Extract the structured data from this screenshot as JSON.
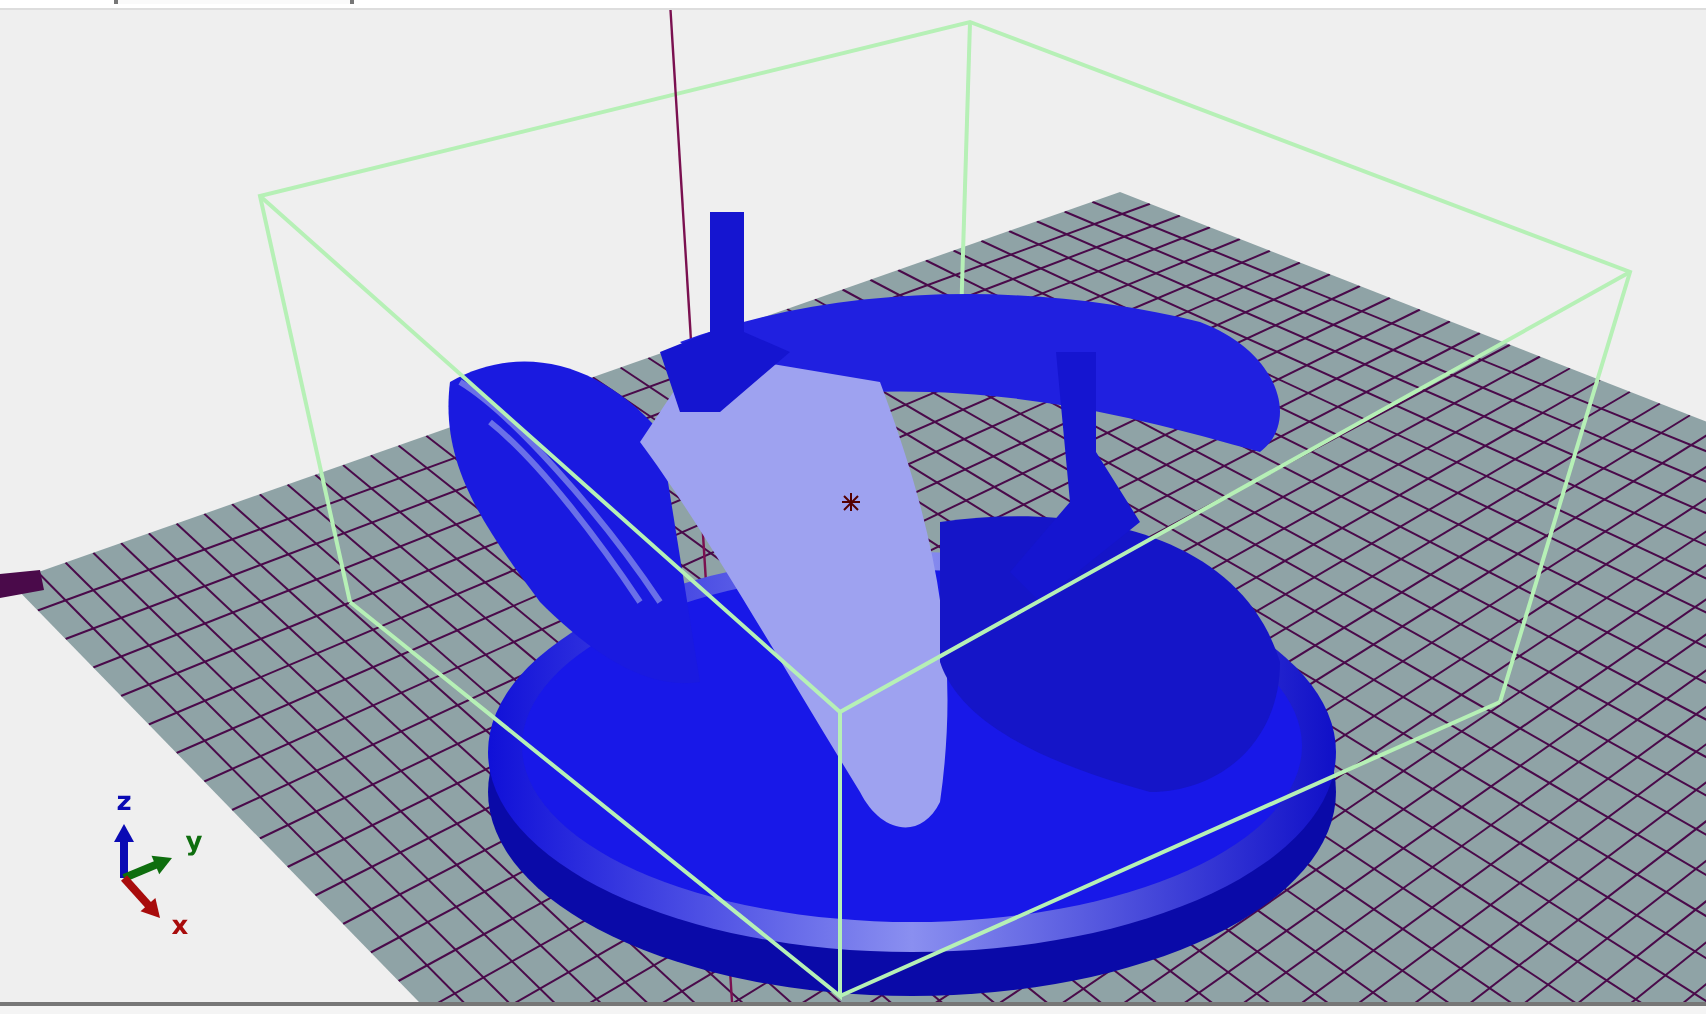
{
  "viewport": {
    "axes": [
      {
        "label": "z",
        "color": "#0a0ab4"
      },
      {
        "label": "y",
        "color": "#0e6e0e"
      },
      {
        "label": "x",
        "color": "#a80c0c"
      }
    ]
  }
}
